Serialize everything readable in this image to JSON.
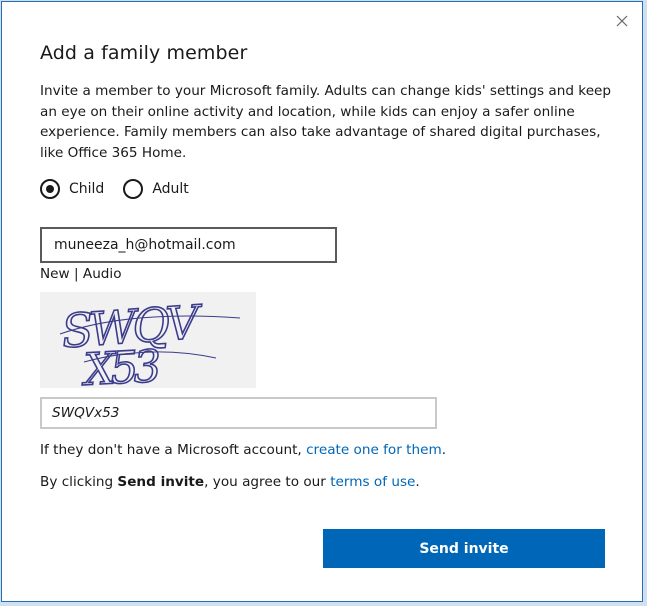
{
  "dialog": {
    "title": "Add a family member",
    "description": "Invite a member to your Microsoft family. Adults can change kids' settings and keep an eye on their online activity and location, while kids can enjoy a safer online experience. Family members can also take advantage of shared digital purchases, like Office 365 Home.",
    "close_icon": "close-icon"
  },
  "member_type": {
    "options": [
      {
        "label": "Child",
        "selected": true
      },
      {
        "label": "Adult",
        "selected": false
      }
    ]
  },
  "email": {
    "value": "muneeza_h@hotmail.com"
  },
  "captcha": {
    "new_label": "New",
    "separator": " | ",
    "audio_label": "Audio",
    "image_text_line1": "SWQV",
    "image_text_line2": "X53",
    "input_value": "SWQVx53"
  },
  "no_account": {
    "prefix": "If they don't have a Microsoft account, ",
    "link": "create one for them",
    "suffix": "."
  },
  "terms": {
    "prefix": "By clicking ",
    "bold": "Send invite",
    "middle": ", you agree to our ",
    "link": "terms of use",
    "suffix": "."
  },
  "actions": {
    "send_label": "Send invite"
  },
  "colors": {
    "accent": "#0067b8",
    "border": "#2b6cb8"
  }
}
